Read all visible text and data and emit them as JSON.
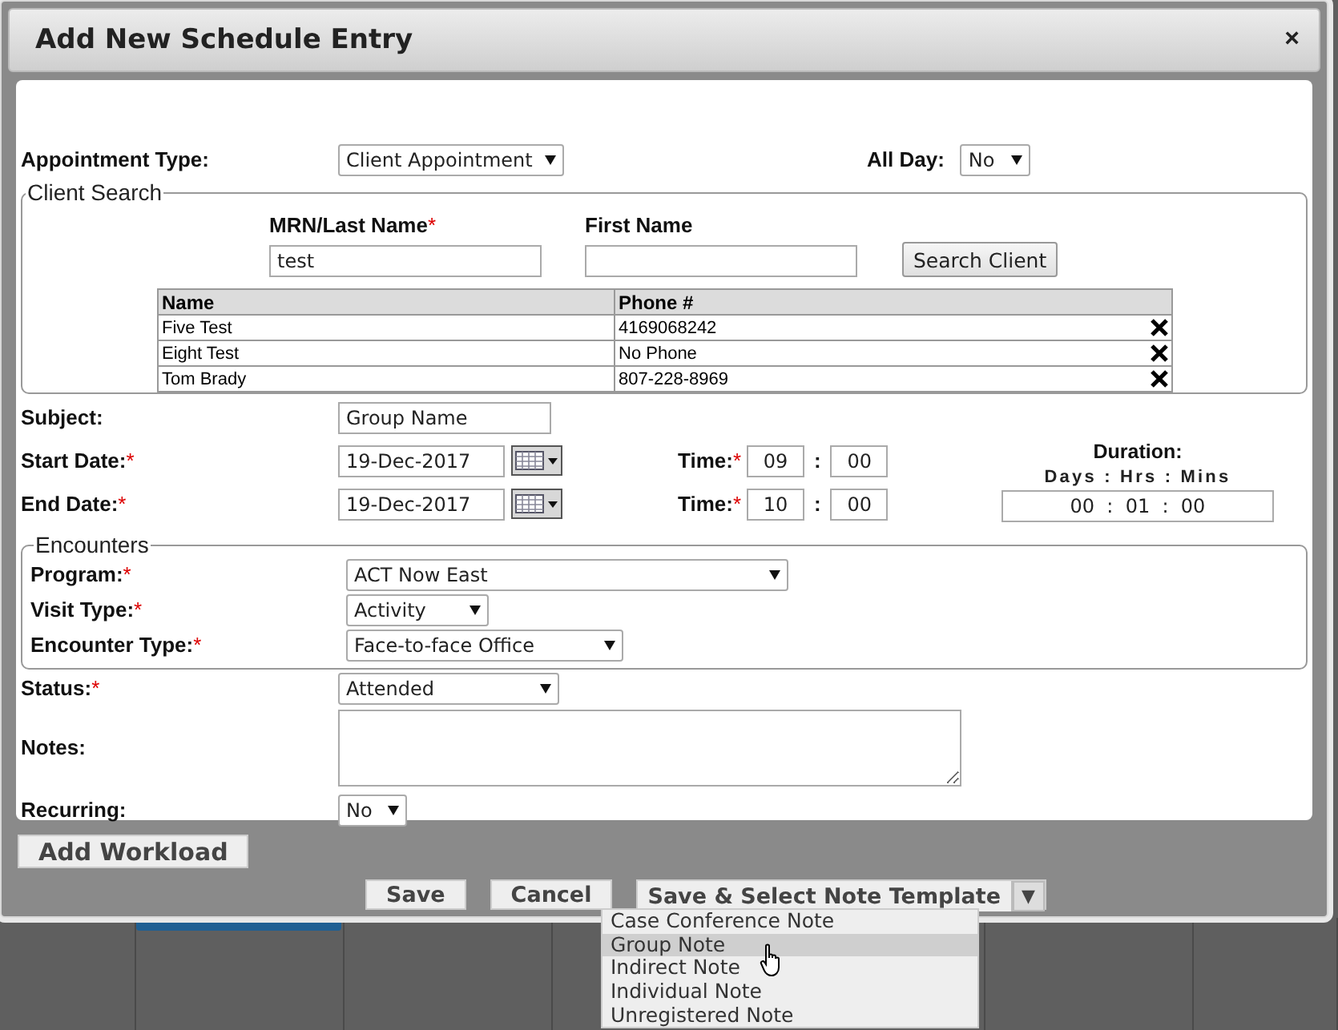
{
  "dialog": {
    "title": "Add New Schedule Entry",
    "close": "×"
  },
  "appointment_type": {
    "label": "Appointment Type:",
    "value": "Client Appointment"
  },
  "all_day": {
    "label": "All Day:",
    "value": "No"
  },
  "client_search": {
    "legend": "Client Search",
    "fields": [
      {
        "label": "MRN/Last Name",
        "mark": "*",
        "value": "test"
      },
      {
        "label": "First Name"
      }
    ],
    "button": "Search Client",
    "columns": [
      "Name",
      "Phone #"
    ],
    "rows": [
      {
        "name": "Five Test",
        "phone": "4169068242"
      },
      {
        "name": "Eight Test",
        "phone": "No Phone"
      },
      {
        "name": "Tom Brady",
        "phone": "807-228-8969"
      }
    ]
  },
  "subject": {
    "label": "Subject:",
    "value": "Group Name"
  },
  "dates": [
    {
      "label": "Start Date:",
      "mark": "*",
      "date": "19-Dec-2017",
      "time_label": "Time:",
      "time_mark": "*",
      "hour": "09",
      "separator": ":",
      "minute": "00"
    },
    {
      "label": "End Date:",
      "mark": "*",
      "date": "19-Dec-2017",
      "time_label": "Time:",
      "time_mark": "*",
      "hour": "10",
      "separator": ":",
      "minute": "00"
    }
  ],
  "duration": {
    "label": "Duration:",
    "units": "Days : Hrs : Mins",
    "value": "00  :  01  :  00"
  },
  "encounters": {
    "legend": "Encounters",
    "fields": [
      {
        "label": "Program:",
        "mark": "*",
        "value": "ACT Now East"
      },
      {
        "label": "Visit Type:",
        "mark": "*",
        "value": "Activity"
      },
      {
        "label": "Encounter Type:",
        "mark": "*",
        "value": "Face-to-face Office"
      }
    ]
  },
  "status": {
    "label": "Status:",
    "mark": "*",
    "value": "Attended"
  },
  "notes": {
    "label": "Notes:"
  },
  "recurring": {
    "label": "Recurring:",
    "value": "No"
  },
  "add_workload": "Add Workload",
  "buttons": [
    {
      "label": "Save"
    },
    {
      "label": "Cancel"
    }
  ],
  "split_button": {
    "label": "Save & Select Note Template",
    "toggle": "▼",
    "expanded": true
  },
  "menu": [
    {
      "label": "Case Conference Note",
      "selected": false
    },
    {
      "label": "Group Note",
      "selected": true
    },
    {
      "label": "Indirect Note",
      "selected": false
    },
    {
      "label": "Individual Note",
      "selected": false
    },
    {
      "label": "Unregistered Note",
      "selected": false
    }
  ]
}
